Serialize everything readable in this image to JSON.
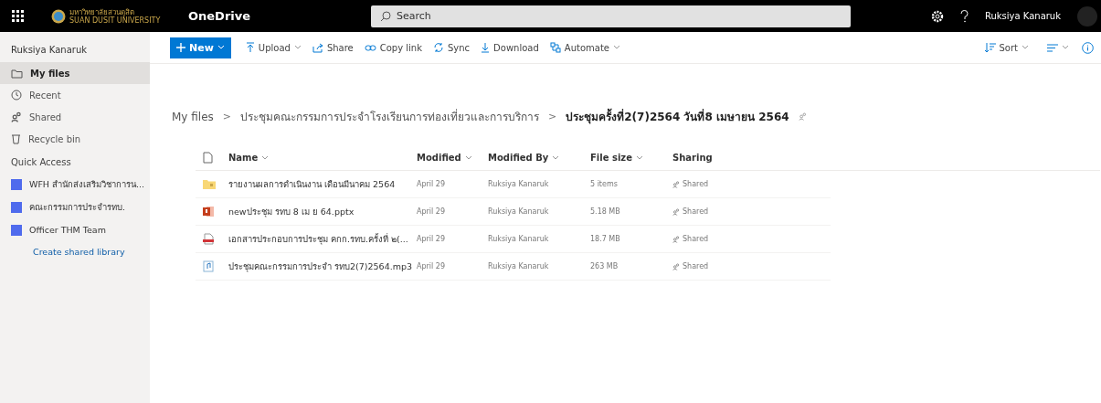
{
  "top_bar": {
    "logo_text": "มหาวิทยาลัยสวนดุสิต",
    "logo_subtext": "SUAN DUSIT UNIVERSITY",
    "app_name": "OneDrive",
    "search": {
      "placeholder": "Search"
    },
    "user_name": "Ruksiya Kanaruk"
  },
  "sidebar": {
    "user_name": "Ruksiya Kanaruk",
    "items": [
      {
        "label": "My files",
        "kind": "folder",
        "selected": true
      },
      {
        "label": "Recent",
        "kind": "clock",
        "selected": false
      },
      {
        "label": "Shared",
        "kind": "people",
        "selected": false
      },
      {
        "label": "Recycle bin",
        "kind": "bin",
        "selected": false
      }
    ],
    "quick_access_title": "Quick Access",
    "quick_access": [
      {
        "label": "WFH สำนักส่งเสริมวิชาการน...",
        "color": "#4f6bed"
      },
      {
        "label": "คณะกรรมการประจำรทบ.",
        "color": "#4f6bed"
      },
      {
        "label": "Officer THM Team",
        "color": "#4f6bed"
      }
    ],
    "create_link": "Create shared library"
  },
  "command_bar": {
    "new_button": "New",
    "commands": [
      {
        "label": "Upload",
        "kind": "upload",
        "dropdown": true
      },
      {
        "label": "Share",
        "kind": "share",
        "dropdown": false
      },
      {
        "label": "Copy link",
        "kind": "link",
        "dropdown": false
      },
      {
        "label": "Sync",
        "kind": "sync",
        "dropdown": false
      },
      {
        "label": "Download",
        "kind": "download",
        "dropdown": false
      },
      {
        "label": "Automate",
        "kind": "flow",
        "dropdown": true
      }
    ],
    "sort": "Sort"
  },
  "breadcrumb_separator": ">",
  "breadcrumb": [
    "My files",
    "ประชุมคณะกรรมการประจำโรงเรียนการท่องเที่ยวและการบริการ",
    "ประชุมครั้งที่2(7)2564 วันที่8 เมษายน 2564"
  ],
  "table": {
    "columns": [
      {
        "label": "Name",
        "sortable": true
      },
      {
        "label": "Modified",
        "sortable": true
      },
      {
        "label": "Modified By",
        "sortable": true
      },
      {
        "label": "File size",
        "sortable": true
      },
      {
        "label": "Sharing",
        "sortable": false
      }
    ],
    "rows": [
      {
        "kind": "folder",
        "name": "รายงานผลการดำเนินงาน เดือนมีนาคม 2564",
        "modified": "April 29",
        "modified_by": "Ruksiya Kanaruk",
        "size": "5 items",
        "sharing": "Shared"
      },
      {
        "kind": "pptx",
        "name": "newประชุม รทบ 8 เม ย 64.pptx",
        "modified": "April 29",
        "modified_by": "Ruksiya Kanaruk",
        "size": "5.18 MB",
        "sharing": "Shared"
      },
      {
        "kind": "pdf",
        "name": "เอกสารประกอบการประชุม คกก.รทบ.ครั้งที่ ๒(...",
        "modified": "April 29",
        "modified_by": "Ruksiya Kanaruk",
        "size": "18.7 MB",
        "sharing": "Shared"
      },
      {
        "kind": "audio",
        "name": "ประชุมคณะกรรมการประจำ รทบ2(7)2564.mp3",
        "modified": "April 29",
        "modified_by": "Ruksiya Kanaruk",
        "size": "263 MB",
        "sharing": "Shared"
      }
    ]
  }
}
